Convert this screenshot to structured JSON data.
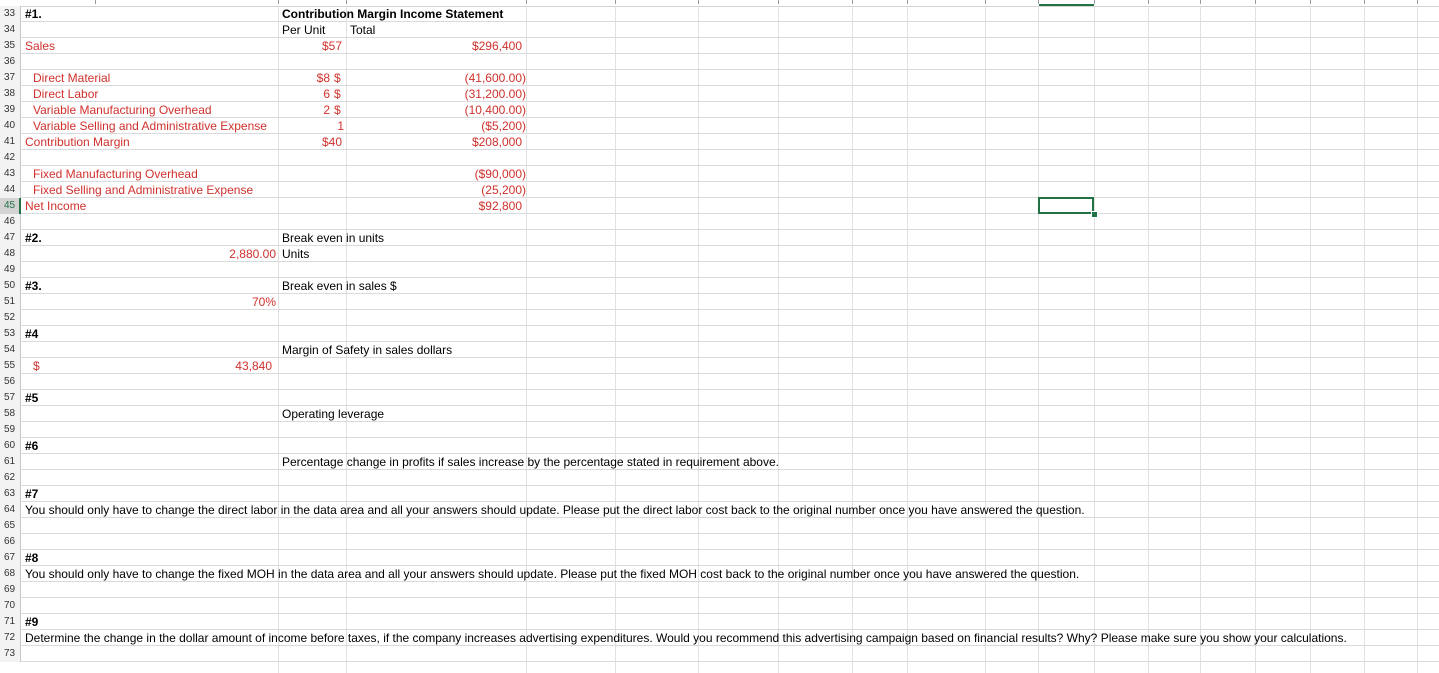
{
  "rows": {
    "33": {
      "num": "33",
      "a": "#1.",
      "title": "Contribution Margin Income Statement"
    },
    "34": {
      "num": "34",
      "h_per_unit": "Per Unit",
      "h_total": "Total"
    },
    "35": {
      "num": "35",
      "a": "Sales",
      "per_unit": "$57",
      "total": "$296,400"
    },
    "36": {
      "num": "36"
    },
    "37": {
      "num": "37",
      "a": "Direct Material",
      "per_unit": "$8",
      "dollar": "$",
      "total": "(41,600.00)"
    },
    "38": {
      "num": "38",
      "a": "Direct Labor",
      "per_unit": "6",
      "dollar": "$",
      "total": "(31,200.00)"
    },
    "39": {
      "num": "39",
      "a": "Variable Manufacturing Overhead",
      "per_unit": "2",
      "dollar": "$",
      "total": "(10,400.00)"
    },
    "40": {
      "num": "40",
      "a": "Variable Selling and Administrative Expense",
      "per_unit": "1",
      "total": "($5,200)"
    },
    "41": {
      "num": "41",
      "a": "Contribution Margin",
      "per_unit": "$40",
      "total": "$208,000"
    },
    "42": {
      "num": "42"
    },
    "43": {
      "num": "43",
      "a": "Fixed Manufacturing Overhead",
      "total": "($90,000)"
    },
    "44": {
      "num": "44",
      "a": "Fixed Selling and Administrative Expense",
      "total": "(25,200)"
    },
    "45": {
      "num": "45",
      "a": "Net Income",
      "total": "$92,800"
    },
    "46": {
      "num": "46"
    },
    "47": {
      "num": "47",
      "a": "#2.",
      "c": "Break even in units"
    },
    "48": {
      "num": "48",
      "b": "2,880.00",
      "c": "Units"
    },
    "49": {
      "num": "49"
    },
    "50": {
      "num": "50",
      "a": "#3.",
      "c": "Break even in sales $"
    },
    "51": {
      "num": "51",
      "b": "70%"
    },
    "52": {
      "num": "52"
    },
    "53": {
      "num": "53",
      "a": "#4"
    },
    "54": {
      "num": "54",
      "c": "Margin of Safety in sales dollars"
    },
    "55": {
      "num": "55",
      "a": "$",
      "b": "43,840"
    },
    "56": {
      "num": "56"
    },
    "57": {
      "num": "57",
      "a": "#5"
    },
    "58": {
      "num": "58",
      "c": "Operating leverage"
    },
    "59": {
      "num": "59"
    },
    "60": {
      "num": "60",
      "a": "#6"
    },
    "61": {
      "num": "61",
      "c": "Percentage change in profits if sales increase by the percentage stated in requirement above."
    },
    "62": {
      "num": "62"
    },
    "63": {
      "num": "63",
      "a": "#7"
    },
    "64": {
      "num": "64",
      "a": "You should only have to change the direct labor in the data area and all your answers should  update.  Please put the direct labor cost back to the original number once you have answered the question."
    },
    "65": {
      "num": "65"
    },
    "66": {
      "num": "66"
    },
    "67": {
      "num": "67",
      "a": "#8"
    },
    "68": {
      "num": "68",
      "a": "You should only have to change the fixed MOH in the data area and  all your answers should update.  Please put the fixed MOH cost back to the original number once you have answered the question."
    },
    "69": {
      "num": "69"
    },
    "70": {
      "num": "70"
    },
    "71": {
      "num": "71",
      "a": "#9"
    },
    "72": {
      "num": "72",
      "a": "Determine the change in the dollar amount of income before taxes, if the company increases advertising expenditures.  Would you recommend this advertising campaign based on financial results?  Why?  Please make sure you show your calculations."
    },
    "73": {
      "num": "73"
    }
  },
  "colors": {
    "accent": "#217346",
    "red_text": "#d0312d"
  }
}
